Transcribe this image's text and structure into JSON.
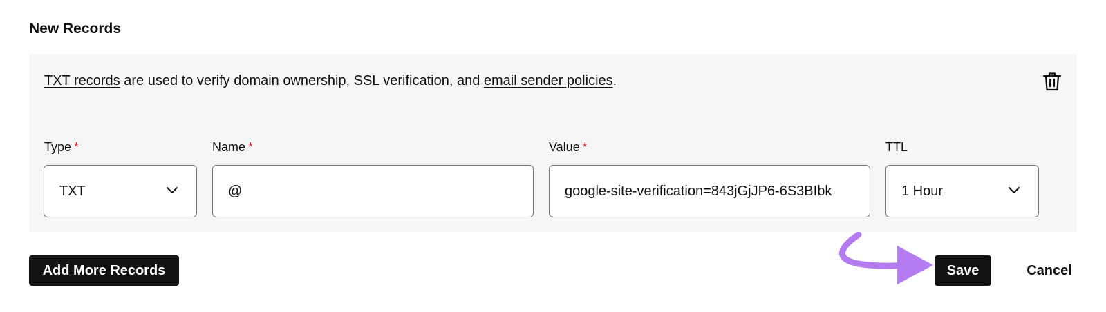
{
  "section": {
    "title": "New Records"
  },
  "info": {
    "link1": "TXT records",
    "text_middle": " are used to verify domain ownership, SSL verification, and ",
    "link2": "email sender policies",
    "text_end": "."
  },
  "fields": {
    "type": {
      "label": "Type",
      "required": "*",
      "value": "TXT"
    },
    "name": {
      "label": "Name",
      "required": "*",
      "value": "@"
    },
    "value": {
      "label": "Value",
      "required": "*",
      "value": "google-site-verification=843jGjJP6-6S3BIbk"
    },
    "ttl": {
      "label": "TTL",
      "value": "1 Hour"
    }
  },
  "actions": {
    "add_more": "Add More Records",
    "save": "Save",
    "cancel": "Cancel"
  },
  "icons": {
    "delete": "trash-icon",
    "dropdown": "chevron-down-icon",
    "annotation": "curved-arrow-annotation"
  },
  "colors": {
    "panel_bg": "#f5f6f7",
    "required": "#d11a1a",
    "button_bg": "#111111",
    "annotation_arrow": "#b57cf2"
  }
}
